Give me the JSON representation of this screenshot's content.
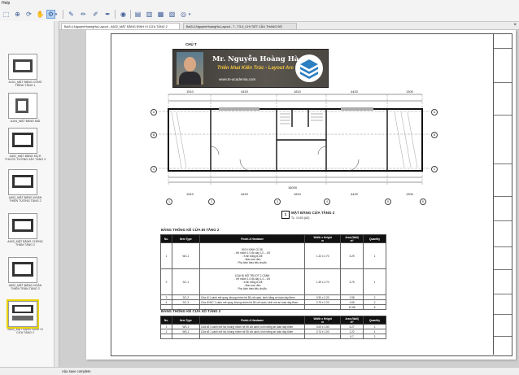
{
  "app": {
    "menu_label": "Help",
    "status_text": "Aào save complete",
    "toolbar_icons": [
      "lasso-icon",
      "zoom-icon",
      "rotate-icon",
      "pointer-icon",
      "settings-icon",
      "pen-icon",
      "pencil-icon",
      "brush-icon",
      "paint-icon",
      "record-icon",
      "page-icon",
      "page-icon",
      "page-icon",
      "page-icon",
      "target-icon",
      "dropdown-icon"
    ]
  },
  "tabs": [
    {
      "label": "Bai3.4-NguyenHoangHa-Layout - A602_MẶT BẰNG ĐỊNH VỊ CỬA TẦNG 2",
      "active": true
    },
    {
      "label": "Bai3.4-NguyenHoangHa-Layout - 7 - T3.0_CHI TIẾT CẦU THANG BỘ",
      "active": false
    }
  ],
  "sidebar": {
    "thumbnails": [
      {
        "label": "A101_MẶT BẰNG CÔNG TRÌNH TẦNG 1",
        "selected": false
      },
      {
        "label": "A104_MẶT BẰNG MÁI",
        "selected": false
      },
      {
        "label": "A401_MẶT BẰNG KÍCH THƯỚC TƯỜNG XÂY TẦNG 3",
        "selected": false
      },
      {
        "label": "A402_MẶT BẰNG HOÀN THIỆN TƯỜNG TẦNG 2",
        "selected": false
      },
      {
        "label": "A403_MẶT BẰNG CHỐNG THẤM TẦNG 2",
        "selected": false
      },
      {
        "label": "A502_MẶT BẰNG HOÀN THIỆN TRẦN TẦNG 2",
        "selected": false
      },
      {
        "label": "A602_MẶT BẰNG ĐỊNH VỊ CỬA TẦNG 2",
        "selected": true
      }
    ]
  },
  "banner": {
    "name": "Mr. Nguyễn Hoàng Hà",
    "subtitle": "Triển khai Kiến Trúc - Layout Arc",
    "url": "www.tn-academia.com",
    "partial_label": "CHỦ T"
  },
  "plan": {
    "dims_top": [
      "1510",
      "4420",
      "1810",
      "4420",
      "1300"
    ],
    "dims_bottom": [
      "1510",
      "4420",
      "1810",
      "4420",
      "1300"
    ],
    "total_dim": "18000",
    "grid_top": [
      "1",
      "2",
      "3",
      "4",
      "5",
      "6"
    ],
    "grid_side": [
      "A",
      "B",
      "C"
    ],
    "caption": "MẶT BẰNG CỬA TẦNG 2",
    "caption_scale": "TL: 1/100 (A3)",
    "caption_num": "1"
  },
  "schedule_1": {
    "title": "BẢNG THỐNG KÊ CỬA ĐI TẦNG 2",
    "headers": [
      "No.",
      "Item Type",
      "Finish & Hardware",
      "Width x Height",
      "Area (Wall)",
      "Quantity"
    ],
    "header_units": [
      "",
      "",
      "",
      "m",
      "m²",
      ""
    ],
    "rows": [
      {
        "no": "1",
        "type": "WC-1",
        "finish": [
          "KÍCH KÍNH CỬ BỊ",
          "- Hệ nhôm 1.0 độ dày 1,0 – 1/5",
          "- Kính trắng 8,0/8",
          "- Màu sơn đen",
          "Phụ kiện theo tiêu chuẩn"
        ],
        "size": "1.22 x 2.70",
        "area": "3.29",
        "qty": "1"
      },
      {
        "no": "2",
        "type": "DC-1",
        "finish": [
          "LOẠI ĐI MỞ TRƯỢT 2 CÁNH",
          "- Hệ nhôm 1.0 độ dày 1,4 – 1/5",
          "- Kính trắng 8,0/8",
          "- Màu sơn đen",
          "Phụ kiện theo tiêu chuẩn"
        ],
        "size": "1.39 x 2.70",
        "area": "3.75",
        "qty": "1"
      },
      {
        "no": "3",
        "type": "DC-2",
        "finish": [
          "Cửa đi 1 cánh mở quay, khung nhôm hệ 55 cốt cạnh, kính trắng an toàn dày 8mm"
        ],
        "size": "0.90 x 2.20",
        "area": "1.98",
        "qty": "2"
      },
      {
        "no": "4",
        "type": "DC-3",
        "finish": [
          "Cửa đi WC 1 cánh mở quay, khung nhôm hệ 55 cốt cạnh, kính mờ an toàn dày 8mm"
        ],
        "size": "0.75 x 2.20",
        "area": "1.65",
        "qty": "2"
      }
    ],
    "total_area": "10.68",
    "total_qty": "6"
  },
  "schedule_2": {
    "title": "BẢNG THỐNG KÊ CỬA SỔ TẦNG 2",
    "headers": [
      "No.",
      "Item Type",
      "Finish & Hardware",
      "Width x Height",
      "Area (Wall)",
      "Quantity"
    ],
    "header_units": [
      "",
      "",
      "",
      "m",
      "m²",
      ""
    ],
    "rows": [
      {
        "no": "1",
        "type": "WS-1",
        "finish": "Cửa sổ 4 cánh mở lật, khung nhôm hệ 55 cốt cạnh, kính trắng an toàn dày 6mm",
        "size": "3.00 x 1.50",
        "area": "4.27",
        "qty": "1"
      },
      {
        "no": "2",
        "type": "WS-1",
        "finish": "Cửa sổ 1 cánh mở lật, khung nhôm hệ 55 cốt cạnh, kính trắng an toàn dày 6mm",
        "size": "0.74 x 1.00",
        "area": "1.22",
        "qty": "1"
      }
    ],
    "total_area": "5.7",
    "total_qty": "2"
  }
}
